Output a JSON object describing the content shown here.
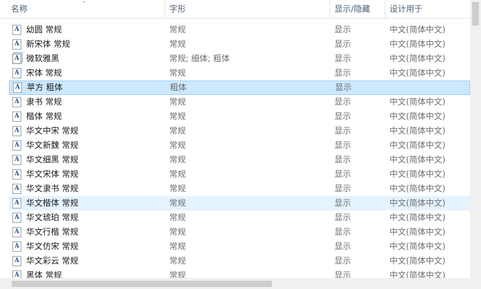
{
  "columns": {
    "name": "名称",
    "style": "字形",
    "show": "显示/隐藏",
    "design": "设计用于"
  },
  "fonts": [
    {
      "name": "幼圆 常规",
      "style": "常规",
      "show": "显示",
      "design": "中文(简体中文)",
      "icon": "font-file-icon"
    },
    {
      "name": "新宋体 常规",
      "style": "常规",
      "show": "显示",
      "design": "中文(简体中文)",
      "icon": "font-file-icon"
    },
    {
      "name": "微软雅黑",
      "style": "常规; 细体; 粗体",
      "show": "显示",
      "design": "中文(简体中文)",
      "icon": "font-family-icon"
    },
    {
      "name": "宋体 常规",
      "style": "常规",
      "show": "显示",
      "design": "中文(简体中文)",
      "icon": "font-file-icon"
    },
    {
      "name": "苹方 粗体",
      "style": "粗体",
      "show": "显示",
      "design": "",
      "icon": "font-file-icon",
      "state": "selected"
    },
    {
      "name": "隶书 常规",
      "style": "常规",
      "show": "显示",
      "design": "中文(简体中文)",
      "icon": "font-file-icon"
    },
    {
      "name": "楷体 常规",
      "style": "常规",
      "show": "显示",
      "design": "中文(简体中文)",
      "icon": "font-file-icon"
    },
    {
      "name": "华文中宋 常规",
      "style": "常规",
      "show": "显示",
      "design": "中文(简体中文)",
      "icon": "font-file-icon"
    },
    {
      "name": "华文新魏 常规",
      "style": "常规",
      "show": "显示",
      "design": "中文(简体中文)",
      "icon": "font-file-icon"
    },
    {
      "name": "华文细黑 常规",
      "style": "常规",
      "show": "显示",
      "design": "中文(简体中文)",
      "icon": "font-file-icon"
    },
    {
      "name": "华文宋体 常规",
      "style": "常规",
      "show": "显示",
      "design": "中文(简体中文)",
      "icon": "font-file-icon"
    },
    {
      "name": "华文隶书 常规",
      "style": "常规",
      "show": "显示",
      "design": "中文(简体中文)",
      "icon": "font-file-icon"
    },
    {
      "name": "华文楷体 常规",
      "style": "常规",
      "show": "显示",
      "design": "中文(简体中文)",
      "icon": "font-file-icon",
      "state": "hover"
    },
    {
      "name": "华文琥珀 常规",
      "style": "常规",
      "show": "显示",
      "design": "中文(简体中文)",
      "icon": "font-file-icon"
    },
    {
      "name": "华文行楷 常规",
      "style": "常规",
      "show": "显示",
      "design": "中文(简体中文)",
      "icon": "font-file-icon"
    },
    {
      "name": "华文仿宋 常规",
      "style": "常规",
      "show": "显示",
      "design": "中文(简体中文)",
      "icon": "font-file-icon"
    },
    {
      "name": "华文彩云 常规",
      "style": "常规",
      "show": "显示",
      "design": "中文(简体中文)",
      "icon": "font-file-icon"
    },
    {
      "name": "黑体 常规",
      "style": "常规",
      "show": "显示",
      "design": "中文(简体中文)",
      "icon": "font-file-icon"
    }
  ],
  "colors": {
    "selected_bg": "#cce8ff",
    "selected_border": "#99d1ff",
    "hover_bg": "#e5f3ff",
    "header_text": "#4c607a"
  }
}
